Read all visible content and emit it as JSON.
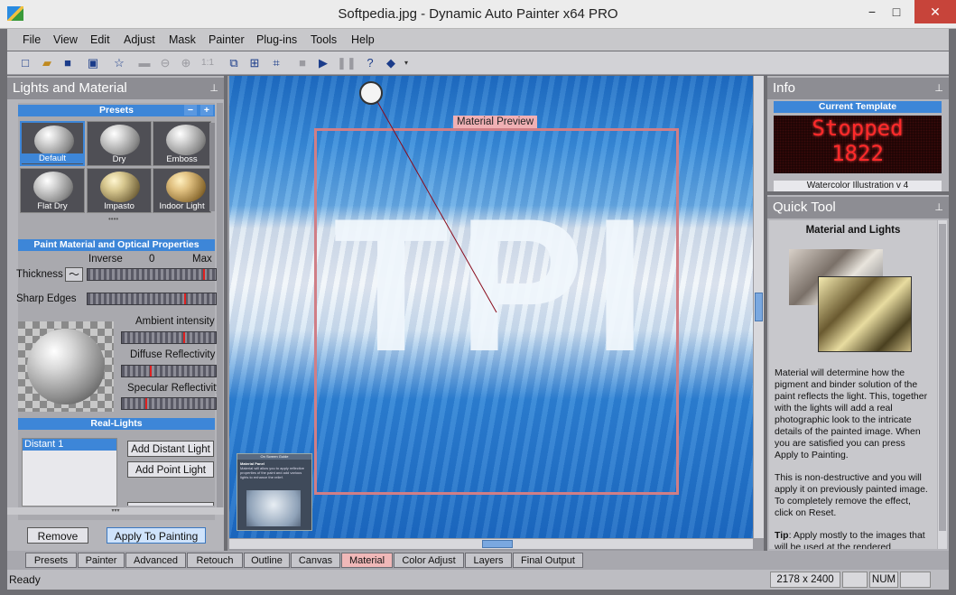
{
  "window": {
    "title": "Softpedia.jpg - Dynamic Auto Painter x64 PRO",
    "min": "−",
    "max": "□",
    "close": "✕"
  },
  "menu": [
    "File",
    "View",
    "Edit",
    "Adjust",
    "Mask",
    "Painter",
    "Plug-ins",
    "Tools",
    "Help"
  ],
  "toolbar": {
    "zoom_ratio": "1:1",
    "help_glyph": "?"
  },
  "left_panel": {
    "title": "Lights and Material",
    "presets_label": "Presets",
    "presets_ctrl": [
      "−",
      "+"
    ],
    "presets": [
      "Default",
      "Dry",
      "Emboss",
      "Flat Dry",
      "Impasto",
      "Indoor Light"
    ],
    "paint_section": "Paint Material and Optical Properties",
    "scale": {
      "inverse": "Inverse",
      "zero": "0",
      "max": "Max"
    },
    "thickness_label": "Thickness",
    "sharp_edges_label": "Sharp Edges",
    "ambient_label": "Ambient intensity",
    "diffuse_label": "Diffuse Reflectivity",
    "specular_label": "Specular Reflectivity",
    "real_lights_label": "Real-Lights",
    "lights": [
      "Distant 1"
    ],
    "add_distant": "Add Distant Light",
    "add_point": "Add Point Light",
    "remove": "Remove",
    "apply": "Apply To Painting",
    "thickness_value": 0.9,
    "sharp_edges_value": 0.75,
    "ambient_value": 0.65,
    "diffuse_value": 0.3,
    "specular_value": 0.25
  },
  "canvas": {
    "material_preview_label": "Material Preview",
    "big_text": "TPI",
    "guide_title": "On Screen Guide",
    "guide_heading": "Material Panel",
    "guide_text": "Material will allow you to apply reflective properties of the paint and add various lights to enhance the relief."
  },
  "info_panel": {
    "title": "Info",
    "current_template_label": "Current Template",
    "led_status": "Stopped",
    "led_number": "1822",
    "template_name": "Watercolor Illustration v 4"
  },
  "quick_tool": {
    "title": "Quick Tool",
    "heading": "Material and Lights",
    "para1": "Material will determine how the pigment and binder solution of the paint reflects the light. This, together with the lights will add a real photographic look to the intricate details of the painted image. When you are satisfied you can press Apply to Painting.",
    "para2": "This is non-destructive and you will apply it on previously painted image. To completely remove the effect, click on Reset.",
    "tip_label": "Tip",
    "tip_text": ": Apply mostly to the images that will be used at the rendered"
  },
  "tabs": [
    "Presets",
    "Painter",
    "Advanced",
    "Retouch",
    "Outline",
    "Canvas",
    "Material",
    "Color Adjust",
    "Layers",
    "Final Output"
  ],
  "active_tab": "Material",
  "status": {
    "text": "Ready",
    "dimensions": "2178 x 2400",
    "num": "NUM"
  },
  "colors": {
    "accent_blue": "#3d86d8",
    "led_red": "#ff2a2a",
    "preview_frame": "#d07e86"
  }
}
